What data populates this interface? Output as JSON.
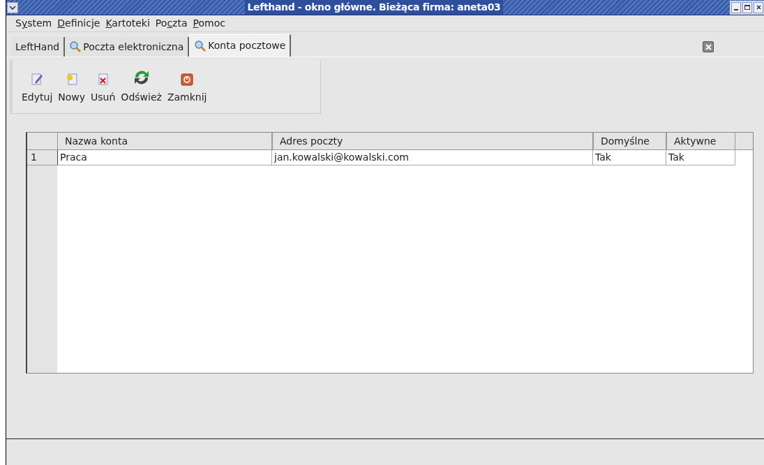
{
  "window": {
    "title": "Lefthand - okno główne. Bieżąca firma: aneta03"
  },
  "menu": [
    {
      "parts": [
        {
          "text": "S",
          "underlined": false
        },
        {
          "text": "y",
          "underlined": true
        },
        {
          "text": "stem",
          "underlined": false
        }
      ]
    },
    {
      "parts": [
        {
          "text": "D",
          "underlined": true
        },
        {
          "text": "efinicje",
          "underlined": false
        }
      ]
    },
    {
      "parts": [
        {
          "text": "K",
          "underlined": true
        },
        {
          "text": "artoteki",
          "underlined": false
        }
      ]
    },
    {
      "parts": [
        {
          "text": "Po",
          "underlined": false
        },
        {
          "text": "c",
          "underlined": true
        },
        {
          "text": "zta",
          "underlined": false
        }
      ]
    },
    {
      "parts": [
        {
          "text": "P",
          "underlined": true
        },
        {
          "text": "omoc",
          "underlined": false
        }
      ]
    }
  ],
  "tabs": [
    {
      "label": "LeftHand",
      "kind": "plain",
      "selected": false
    },
    {
      "label": "Poczta elektroniczna",
      "kind": "search",
      "selected": false
    },
    {
      "label": "Konta pocztowe",
      "kind": "search",
      "selected": true
    }
  ],
  "toolbar": [
    {
      "label": "Edytuj",
      "kind": "edit"
    },
    {
      "label": "Nowy",
      "kind": "new"
    },
    {
      "label": "Usuń",
      "kind": "delete"
    },
    {
      "label": "Odśwież",
      "kind": "refresh"
    },
    {
      "label": "Zamknij",
      "kind": "close"
    }
  ],
  "table": {
    "columns": [
      "Nazwa konta",
      "Adres poczty",
      "Domyślne",
      "Aktywne"
    ],
    "rows": [
      {
        "number": "1",
        "cells": [
          "Praca",
          "jan.kowalski@kowalski.com",
          "Tak",
          "Tak"
        ]
      }
    ]
  }
}
